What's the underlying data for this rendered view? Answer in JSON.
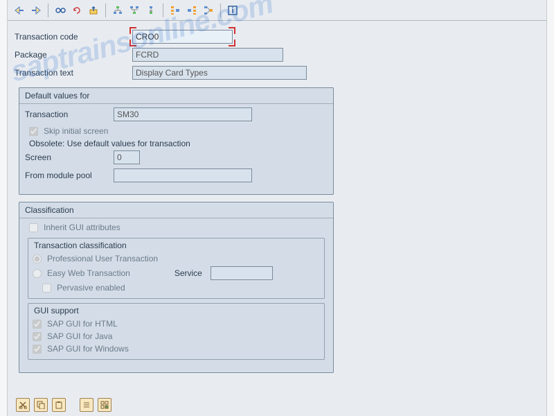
{
  "watermark": "saptrainsonline.com",
  "header": {
    "transaction_code_label": "Transaction code",
    "transaction_code_value": "CRO0",
    "package_label": "Package",
    "package_value": "FCRD",
    "transaction_text_label": "Transaction text",
    "transaction_text_value": "Display Card Types"
  },
  "defaults": {
    "title": "Default values for",
    "transaction_label": "Transaction",
    "transaction_value": "SM30",
    "skip_initial_label": "Skip initial screen",
    "skip_initial_checked": true,
    "obsolete_text": "Obsolete: Use default values for transaction",
    "screen_label": "Screen",
    "screen_value": "0",
    "module_pool_label": "From module pool",
    "module_pool_value": ""
  },
  "classification": {
    "title": "Classification",
    "inherit_label": "Inherit GUI attributes",
    "inherit_checked": false,
    "sub_title": "Transaction classification",
    "professional_label": "Professional User Transaction",
    "easy_web_label": "Easy Web Transaction",
    "service_label": "Service",
    "service_value": "",
    "pervasive_label": "Pervasive enabled",
    "selected_radio": "professional"
  },
  "gui_support": {
    "title": "GUI support",
    "html_label": "SAP GUI for HTML",
    "java_label": "SAP GUI for Java",
    "windows_label": "SAP GUI for Windows",
    "html_checked": true,
    "java_checked": true,
    "windows_checked": true
  },
  "icons": {
    "back": "back-arrow",
    "forward": "fwd-arrow",
    "glasses": "glasses",
    "refresh": "refresh",
    "export": "export",
    "hier1": "hier1",
    "hier2": "hier2",
    "hier3": "hier3",
    "tree1": "tree1",
    "tree2": "tree2",
    "tree3": "tree3",
    "info": "info"
  }
}
